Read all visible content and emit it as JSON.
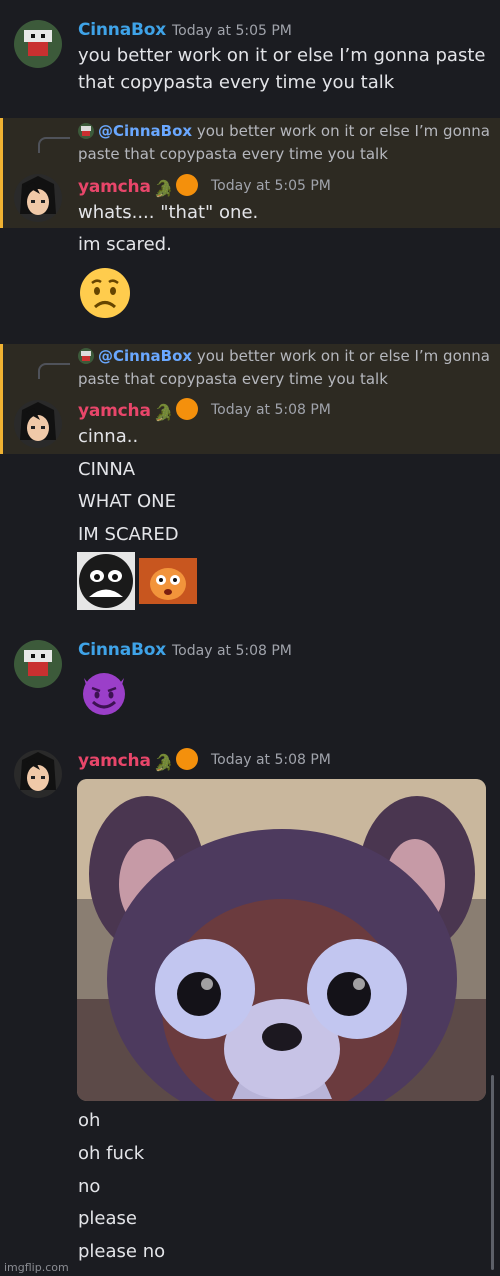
{
  "messages": [
    {
      "author": "CinnaBox",
      "timestamp": "Today at 5:05 PM",
      "lines": [
        "you better work on it or else I’m gonna paste",
        "that copypasta every time you talk"
      ]
    },
    {
      "author": "yamcha",
      "timestamp": "Today at 5:05 PM",
      "reply": {
        "mention": "@CinnaBox",
        "text_line1": "you better work on it or else I’m gonna",
        "text_line2": "paste that copypasta every time you talk"
      },
      "lines": [
        "whats.... \"that\" one.",
        "im scared."
      ]
    },
    {
      "author": "yamcha",
      "timestamp": "Today at 5:08 PM",
      "reply": {
        "mention": "@CinnaBox",
        "text_line1": "you better work on it or else I’m gonna",
        "text_line2": "paste that copypasta every time you talk"
      },
      "lines": [
        "cinna..",
        "CINNA",
        "WHAT ONE",
        "IM SCARED"
      ]
    },
    {
      "author": "CinnaBox",
      "timestamp": "Today at 5:08 PM"
    },
    {
      "author": "yamcha",
      "timestamp": "Today at 5:08 PM",
      "lines": [
        "oh",
        "oh fuck",
        "no",
        "please",
        "please no"
      ]
    }
  ],
  "watermark": "imgflip.com",
  "colors": {
    "background": "#1b1c21",
    "highlight": "#2d2a22",
    "highlight_bar": "#f0b232",
    "cinnabox_name": "#3fa3e8",
    "yamcha_name": "#e8466a",
    "mention": "#6aa8ff"
  },
  "icons": [
    "worried-face-emoji",
    "smiling-imp-emoji",
    "orange-circle-emoji",
    "crocodile-emoji",
    "sad-custom-emoji",
    "orange-character-emoji"
  ]
}
